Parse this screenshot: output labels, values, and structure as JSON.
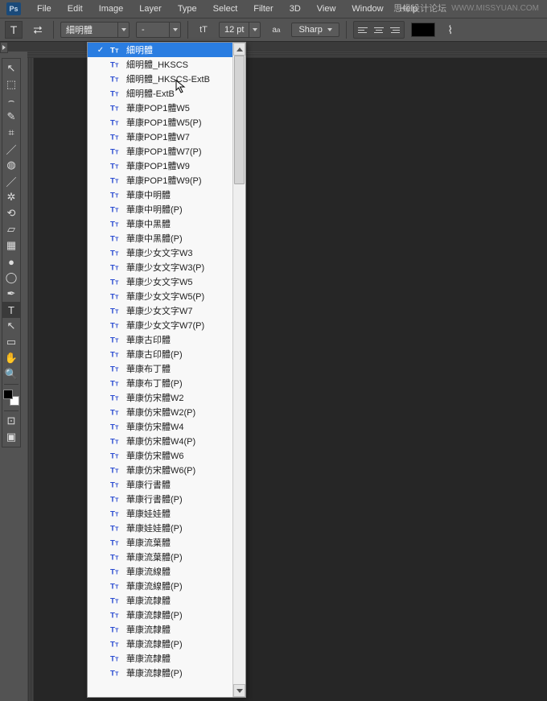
{
  "menubar": {
    "items": [
      "File",
      "Edit",
      "Image",
      "Layer",
      "Type",
      "Select",
      "Filter",
      "3D",
      "View",
      "Window",
      "Help"
    ]
  },
  "watermark": {
    "cn": "思缘设计论坛",
    "en": "WWW.MISSYUAN.COM"
  },
  "options_bar": {
    "font_family": "細明體",
    "font_style": "-",
    "font_size": "12 pt",
    "aa_label": "Sharp"
  },
  "toolbox": {
    "tools": [
      {
        "name": "move",
        "glyph": "↖"
      },
      {
        "name": "marquee",
        "glyph": "⬚"
      },
      {
        "name": "lasso",
        "glyph": "⌢"
      },
      {
        "name": "quick-select",
        "glyph": "✎"
      },
      {
        "name": "crop",
        "glyph": "⌗"
      },
      {
        "name": "eyedropper",
        "glyph": "／"
      },
      {
        "name": "healing",
        "glyph": "◍"
      },
      {
        "name": "brush",
        "glyph": "／"
      },
      {
        "name": "clone",
        "glyph": "✲"
      },
      {
        "name": "history-brush",
        "glyph": "⟲"
      },
      {
        "name": "eraser",
        "glyph": "▱"
      },
      {
        "name": "gradient",
        "glyph": "▦"
      },
      {
        "name": "blur",
        "glyph": "●"
      },
      {
        "name": "dodge",
        "glyph": "◯"
      },
      {
        "name": "pen",
        "glyph": "✒"
      },
      {
        "name": "type",
        "glyph": "T"
      },
      {
        "name": "path-select",
        "glyph": "↖"
      },
      {
        "name": "rectangle",
        "glyph": "▭"
      },
      {
        "name": "hand",
        "glyph": "✋"
      },
      {
        "name": "zoom",
        "glyph": "🔍"
      }
    ],
    "active": "type",
    "extra": [
      {
        "name": "edit-toolbar",
        "glyph": "⊡"
      },
      {
        "name": "quick-mask",
        "glyph": "▣"
      }
    ]
  },
  "font_dropdown": {
    "selected_index": 0,
    "cursor_on_index": 2,
    "items": [
      "細明體",
      "細明體_HKSCS",
      "細明體_HKSCS-ExtB",
      "細明體-ExtB",
      "華康POP1體W5",
      "華康POP1體W5(P)",
      "華康POP1體W7",
      "華康POP1體W7(P)",
      "華康POP1體W9",
      "華康POP1體W9(P)",
      "華康中明體",
      "華康中明體(P)",
      "華康中黑體",
      "華康中黑體(P)",
      "華康少女文字W3",
      "華康少女文字W3(P)",
      "華康少女文字W5",
      "華康少女文字W5(P)",
      "華康少女文字W7",
      "華康少女文字W7(P)",
      "華康古印體",
      "華康古印體(P)",
      "華康布丁體",
      "華康布丁體(P)",
      "華康仿宋體W2",
      "華康仿宋體W2(P)",
      "華康仿宋體W4",
      "華康仿宋體W4(P)",
      "華康仿宋體W6",
      "華康仿宋體W6(P)",
      "華康行書體",
      "華康行書體(P)",
      "華康娃娃體",
      "華康娃娃體(P)",
      "華康流葉體",
      "華康流葉體(P)",
      "華康流線體",
      "華康流線體(P)",
      "華康流隸體",
      "華康流隸體(P)",
      "華康流隸體",
      "華康流隸體(P)",
      "華康流隸體",
      "華康流隸體(P)"
    ]
  }
}
